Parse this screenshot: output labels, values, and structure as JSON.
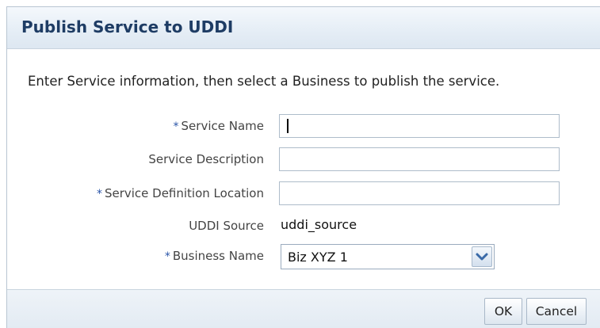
{
  "dialog": {
    "title": "Publish Service to UDDI",
    "instructions": "Enter Service information, then select a Business to publish the service."
  },
  "form": {
    "required_marker": "*",
    "service_name": {
      "label": "Service Name",
      "required": true,
      "value": ""
    },
    "service_description": {
      "label": "Service Description",
      "required": false,
      "value": ""
    },
    "service_definition_location": {
      "label": "Service Definition Location",
      "required": true,
      "value": ""
    },
    "uddi_source": {
      "label": "UDDI Source",
      "value": "uddi_source"
    },
    "business_name": {
      "label": "Business Name",
      "required": true,
      "selected": "Biz XYZ 1"
    }
  },
  "buttons": {
    "ok": "OK",
    "cancel": "Cancel"
  },
  "icons": {
    "dropdown": "chevron-down-icon"
  },
  "colors": {
    "title_text": "#1e3c64",
    "required_marker": "#2a55a8",
    "header_bg": "#e6eef6",
    "chevron": "#3a6aa8"
  }
}
